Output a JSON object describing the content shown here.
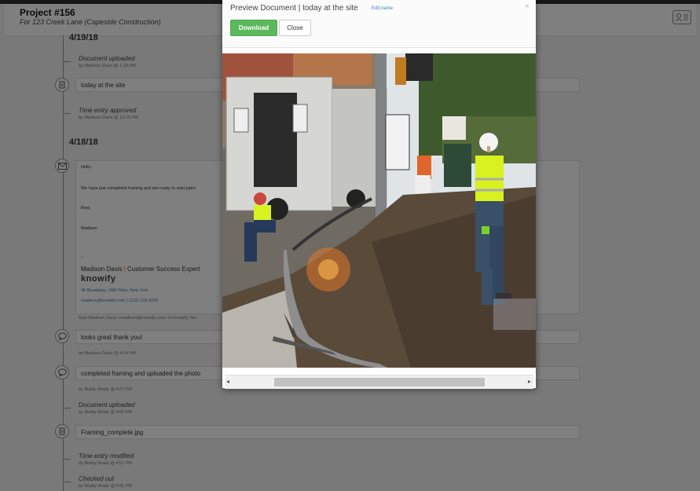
{
  "header": {
    "title": "Project #156",
    "subtitle": "For 123 Creek Lane (Capeside Construction)"
  },
  "timeline": {
    "date1": "4/19/18",
    "event1": {
      "title": "Document uploaded",
      "meta": "by Madison Davis @ 1:18 PM"
    },
    "note1": "today at the site",
    "event2": {
      "title": "Time entry approved",
      "meta": "by Madison Davis @ 12:20 PM"
    },
    "date2": "4/18/18",
    "email": {
      "greeting": "Hello,",
      "body": "We have just completed framing and are ready to start paint",
      "closing": "Best,",
      "name": "Madison",
      "dashes": "--",
      "sig_name": "Madison Davis",
      "sig_sep": "|",
      "sig_role": "Customer Success Expert",
      "logo": "knowify",
      "address": "45 Broadway, 14th Floor, New York",
      "contact": "madison@knowify.com | (212) 233-3230",
      "from": "from Madison Davis <madison@knowify.com> to Knowify Tea"
    },
    "note2": "looks great thank you!",
    "note2_meta": "by Madison Davis @ 4:14 PM",
    "note3": "completed framing and uploaded the photo",
    "note3_meta": "by Bobby Brady @ 4:07 PM",
    "event3": {
      "title": "Document uploaded",
      "meta": "by Bobby Brady @ 4:05 PM"
    },
    "note4": "Framing_complete.jpg",
    "event4": {
      "title": "Time entry modified",
      "meta": "by Bobby Brady @ 4:01 PM"
    },
    "event5": {
      "title": "Checked out",
      "meta": "by Bobby Brady @ 4:01 PM"
    }
  },
  "modal": {
    "title": "Preview Document | today at the site",
    "edit_name": "Edit name",
    "close_glyph": "×",
    "download_label": "Download",
    "close_label": "Close",
    "scroll_left": "◂",
    "scroll_right": "▸"
  },
  "colors": {
    "download": "#5cb85c",
    "link": "#3d7fc4"
  }
}
